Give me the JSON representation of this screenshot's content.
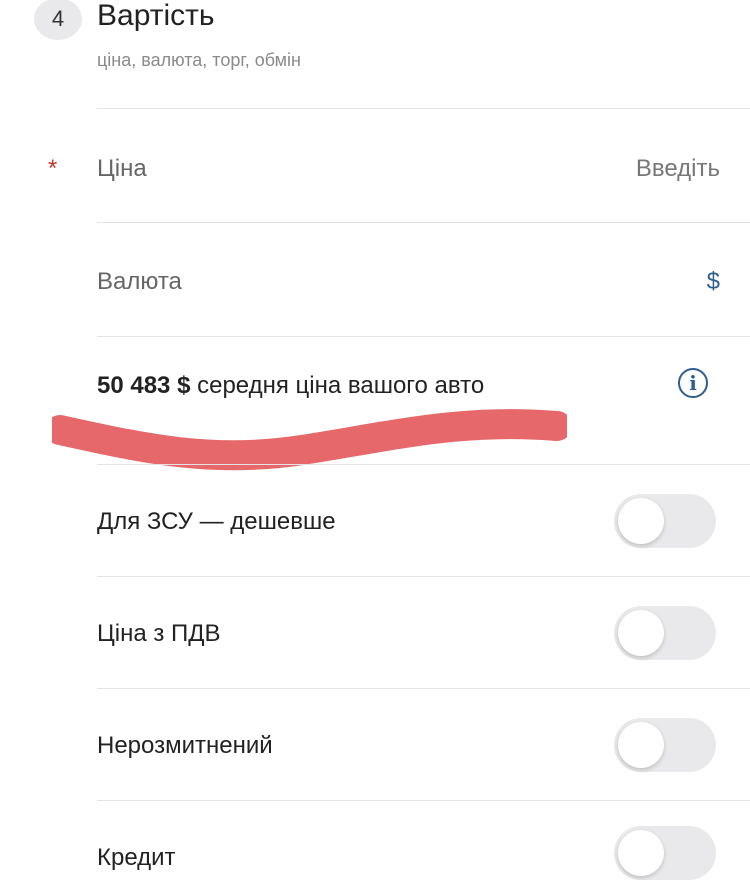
{
  "section": {
    "step_number": "4",
    "title": "Вартість",
    "subtitle": "ціна, валюта, торг, обмін"
  },
  "price": {
    "required_mark": "*",
    "label": "Ціна",
    "placeholder": "Введіть"
  },
  "currency": {
    "label": "Валюта",
    "value": "$"
  },
  "average": {
    "amount": "50 483 $",
    "text": " середня ціна вашого авто"
  },
  "toggles": [
    {
      "label": "Для ЗСУ — дешевше",
      "on": false
    },
    {
      "label": "Ціна з ПДВ",
      "on": false
    },
    {
      "label": "Нерозмитнений",
      "on": false
    },
    {
      "label": "Кредит",
      "on": false
    }
  ],
  "colors": {
    "accent": "#2f5f8f",
    "required": "#c0392b",
    "redaction": "#e4585a"
  }
}
